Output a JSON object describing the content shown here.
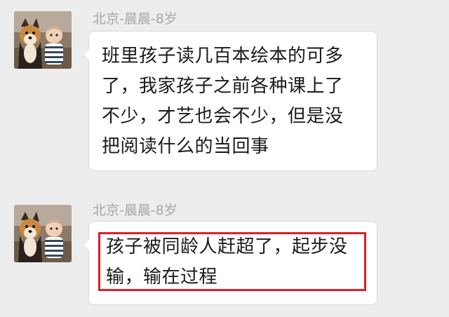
{
  "messages": [
    {
      "sender": "北京-晨晨-8岁",
      "avatar": "avatar-kid-with-dog-icon",
      "lines": [
        "班里孩子读几百本绘本的可多",
        "了，我家孩子之前各种课上了",
        "不少，才艺也会不少，但是没",
        "把阅读什么的当回事"
      ],
      "highlighted": false
    },
    {
      "sender": "北京-晨晨-8岁",
      "avatar": "avatar-kid-with-dog-icon",
      "lines": [
        "孩子被同龄人赶超了，起步没",
        "输，输在过程"
      ],
      "highlighted": true,
      "highlight_color": "#d9212a"
    }
  ],
  "colors": {
    "background": "#ededed",
    "bubble": "#ffffff",
    "sender_text": "#a6a6a6",
    "message_text": "#1a1a1a"
  }
}
